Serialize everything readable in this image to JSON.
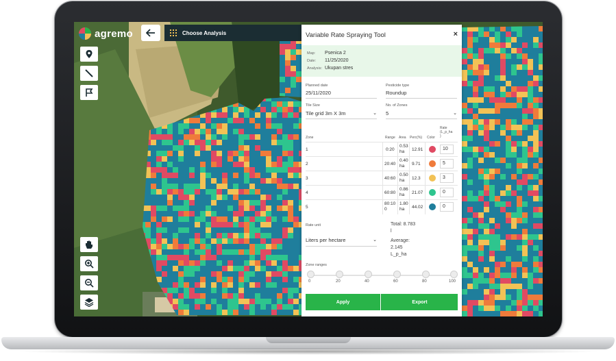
{
  "app": {
    "brand": "agremo",
    "brand_color": "#29b449"
  },
  "topbar": {
    "back_icon": "arrow-left-icon",
    "analysis_label": "Choose Analysis"
  },
  "tools": [
    {
      "name": "location-pin-tool",
      "icon": "location-pin-icon"
    },
    {
      "name": "line-tool",
      "icon": "line-icon"
    },
    {
      "name": "flag-tool",
      "icon": "flag-icon"
    },
    {
      "name": "hand-tool",
      "icon": "hand-icon"
    },
    {
      "name": "zoom-in-tool",
      "icon": "zoom-in-icon"
    },
    {
      "name": "zoom-out-tool",
      "icon": "zoom-out-icon"
    },
    {
      "name": "layers-tool",
      "icon": "layers-icon"
    }
  ],
  "panel": {
    "title": "Variable Rate Spraying Tool",
    "close": "×",
    "info": [
      {
        "key": "Map:",
        "value": "Psenica 2"
      },
      {
        "key": "Date:",
        "value": "11/25/2020"
      },
      {
        "key": "Analysis:",
        "value": "Ukupan stres"
      }
    ],
    "planned_date": {
      "label": "Planned date",
      "value": "25/11/2020"
    },
    "pesticide_type": {
      "label": "Pesticide type",
      "value": "Roundup"
    },
    "tile_size": {
      "label": "Tile Size",
      "value": "Tile grid 3m X 3m"
    },
    "num_zones": {
      "label": "No. of Zones",
      "value": "5"
    },
    "table": {
      "headers": {
        "zone": "Zone",
        "range": "Range",
        "area": "Area",
        "perc": "Perc(%)",
        "color": "Color",
        "rate_line1": "Rate",
        "rate_line2": "(L_p_ha",
        "rate_line3": ")"
      },
      "rows": [
        {
          "zone": "1",
          "range": "0:20",
          "area_value": "0.53",
          "area_unit": "ha",
          "perc": "12.91",
          "color": "#e04a63",
          "rate": "10"
        },
        {
          "zone": "2",
          "range": "20:40",
          "area_value": "0.40",
          "area_unit": "ha",
          "perc": "9.71",
          "color": "#ef7b3b",
          "rate": "5"
        },
        {
          "zone": "3",
          "range": "40:60",
          "area_value": "0.50",
          "area_unit": "ha",
          "perc": "12.3",
          "color": "#f2c256",
          "rate": "3"
        },
        {
          "zone": "4",
          "range": "60:80",
          "area_value": "0.86",
          "area_unit": "ha",
          "perc": "21.07",
          "color": "#2ec58e",
          "rate": "0"
        },
        {
          "zone": "5",
          "range_line1": "80:10",
          "range_line2": "0",
          "area_value": "1.80",
          "area_unit": "ha",
          "perc": "44.02",
          "color": "#1f7e9c",
          "rate": "0"
        }
      ]
    },
    "rate_unit": {
      "label": "Rate unit",
      "value": "Liters per hectare"
    },
    "total": {
      "line1": "Total: 8.783",
      "line2": "l"
    },
    "average": {
      "line1": "Average:",
      "line2": "2.145",
      "line3": "L_p_ha"
    },
    "zone_ranges": {
      "label": "Zone ranges",
      "ticks": [
        "0",
        "20",
        "40",
        "60",
        "80",
        "100"
      ]
    },
    "apply_label": "Apply",
    "export_label": "Export"
  }
}
